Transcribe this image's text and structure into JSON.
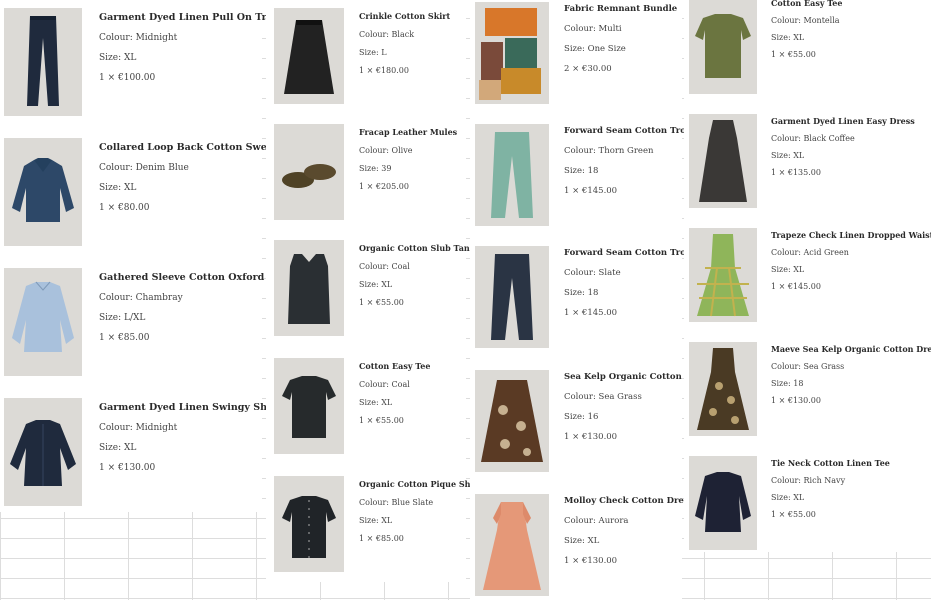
{
  "columns": [
    {
      "items": [
        {
          "title": "Garment Dyed Linen Pull On Trousers",
          "colour": "Colour: Midnight",
          "size": "Size: XL",
          "price": "1 × €100.00",
          "icon": "trousers-image"
        },
        {
          "title": "Collared Loop Back Cotton Sweatshirt",
          "colour": "Colour: Denim Blue",
          "size": "Size: XL",
          "price": "1 × €80.00",
          "icon": "sweatshirt-image"
        },
        {
          "title": "Gathered Sleeve Cotton Oxford Shirt",
          "colour": "Colour: Chambray",
          "size": "Size: L/XL",
          "price": "1 × €85.00",
          "icon": "shirt-image"
        },
        {
          "title": "Garment Dyed Linen Swingy Shirt",
          "colour": "Colour: Midnight",
          "size": "Size: XL",
          "price": "1 × €130.00",
          "icon": "shirt-image"
        }
      ]
    },
    {
      "items": [
        {
          "title": "Crinkle Cotton Skirt",
          "colour": "Colour: Black",
          "size": "Size: L",
          "price": "1 × €180.00",
          "icon": "skirt-image"
        },
        {
          "title": "Fracap Leather Mules",
          "colour": "Colour: Olive",
          "size": "Size: 39",
          "price": "1 × €205.00",
          "icon": "shoes-image"
        },
        {
          "title": "Organic Cotton Slub Tank Top",
          "colour": "Colour: Coal",
          "size": "Size: XL",
          "price": "1 × €55.00",
          "icon": "tank-top-image"
        },
        {
          "title": "Cotton Easy Tee",
          "colour": "Colour: Coal",
          "size": "Size: XL",
          "price": "1 × €55.00",
          "icon": "tee-image"
        },
        {
          "title": "Organic Cotton Pique Shirt",
          "colour": "Colour: Blue Slate",
          "size": "Size: XL",
          "price": "1 × €85.00",
          "icon": "shirt-image"
        }
      ]
    },
    {
      "items": [
        {
          "title": "Fabric Remnant Bundle",
          "colour": "Colour: Multi",
          "size": "Size: One Size",
          "price": "2 × €30.00",
          "icon": "fabric-image"
        },
        {
          "title": "Forward Seam Cotton Trousers",
          "colour": "Colour: Thorn Green",
          "size": "Size: 18",
          "price": "1 × €145.00",
          "icon": "trousers-image"
        },
        {
          "title": "Forward Seam Cotton Trousers",
          "colour": "Colour: Slate",
          "size": "Size: 18",
          "price": "1 × €145.00",
          "icon": "trousers-image"
        },
        {
          "title": "Sea Kelp Organic Cotton Skirt",
          "colour": "Colour: Sea Grass",
          "size": "Size: 16",
          "price": "1 × €130.00",
          "icon": "skirt-image"
        },
        {
          "title": "Molloy Check Cotton Dress",
          "colour": "Colour: Aurora",
          "size": "Size: XL",
          "price": "1 × €130.00",
          "icon": "dress-image"
        }
      ]
    },
    {
      "items": [
        {
          "title": "Cotton Easy Tee",
          "colour": "Colour: Montella",
          "size": "Size: XL",
          "price": "1 × €55.00",
          "icon": "tee-image"
        },
        {
          "title": "Garment Dyed Linen Easy Dress",
          "colour": "Colour: Black Coffee",
          "size": "Size: XL",
          "price": "1 × €135.00",
          "icon": "dress-image"
        },
        {
          "title": "Trapeze Check Linen Dropped Waist Dress",
          "colour": "Colour: Acid Green",
          "size": "Size: XL",
          "price": "1 × €145.00",
          "icon": "dress-image"
        },
        {
          "title": "Maeve Sea Kelp Organic Cotton Dress",
          "colour": "Colour: Sea Grass",
          "size": "Size: 18",
          "price": "1 × €130.00",
          "icon": "dress-image"
        },
        {
          "title": "Tie Neck Cotton Linen Tee",
          "colour": "Colour: Rich Navy",
          "size": "Size: XL",
          "price": "1 × €55.00",
          "icon": "top-image"
        }
      ]
    }
  ],
  "colors": {
    "background": "#ffffff",
    "gridline": "#d8d8d8",
    "thumb_bg": "#dedcd8",
    "text": "#3a3a3a",
    "midnight": "#1f2a3d",
    "denim": "#2d4868",
    "chambray": "#9fb8d6",
    "black": "#2a2a2a",
    "olive": "#5a4a2e",
    "thorn_green": "#7fb3a3",
    "slate": "#2a3444",
    "aurora": "#e59878",
    "montella": "#6b7540",
    "black_coffee": "#3a3836",
    "acid_green": "#8fb55a",
    "rich_navy": "#1e2234"
  }
}
